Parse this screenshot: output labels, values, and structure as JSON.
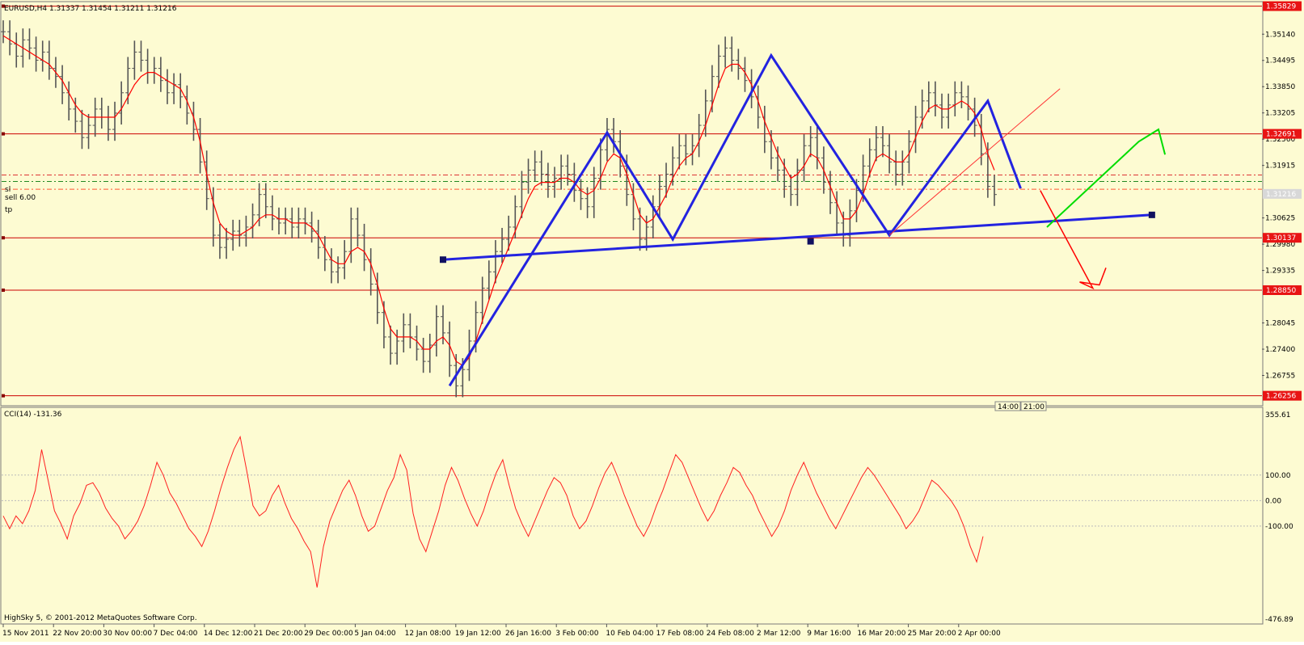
{
  "main_chart": {
    "header_text": "EURUSD,H4  1.31337 1.31454 1.31211 1.31216",
    "line_label_sl": "sl",
    "line_label_sell": "sell 6.00",
    "line_label_tp": "tp",
    "footer_text": "HighSky 5, © 2001-2012 MetaQuotes Software Corp."
  },
  "indicator": {
    "header_text": "CCI(14) -131.36"
  },
  "time_axis_labels": [
    "15 Nov 2011",
    "22 Nov 20:00",
    "30 Nov 00:00",
    "7 Dec 04:00",
    "14 Dec 12:00",
    "21 Dec 20:00",
    "29 Dec 00:00",
    "5 Jan 04:00",
    "12 Jan 08:00",
    "19 Jan 12:00",
    "26 Jan 16:00",
    "3 Feb 00:00",
    "10 Feb 04:00",
    "17 Feb 08:00",
    "24 Feb 08:00",
    "2 Mar 12:00",
    "9 Mar 16:00",
    "16 Mar 20:00",
    "25 Mar 20:00",
    "2 Apr 00:00"
  ],
  "session_labels": [
    "14:00",
    "21:00"
  ],
  "colors": {
    "background": "#fdfbd2",
    "price_bars": "#555555",
    "moving_average": "#ff0000",
    "pattern": "#2323e0",
    "forecast_up": "#00dd00",
    "forecast_down": "#ff0000",
    "level_line": "#cc0000",
    "grid": "#bbbbbb"
  },
  "chart_data": [
    {
      "type": "line",
      "symbol": "EURUSD",
      "timeframe": "H4",
      "ylim": [
        1.2605,
        1.359
      ],
      "y_ticks": [
        "1.35140",
        "1.34495",
        "1.33850",
        "1.33205",
        "1.32560",
        "1.31915",
        "1.30625",
        "1.29980",
        "1.29335",
        "1.28045",
        "1.27400",
        "1.26755"
      ],
      "price_tags": [
        "1.35829",
        "1.32691",
        "1.31216",
        "1.30137",
        "1.28850",
        "1.26256"
      ],
      "horizontal_levels": [
        1.35829,
        1.32691,
        1.30137,
        1.2885,
        1.26256
      ],
      "order_lines": [
        1.3168,
        1.3152,
        1.3133
      ],
      "ohlc_close": [
        1.352,
        1.349,
        1.346,
        1.35,
        1.348,
        1.345,
        1.347,
        1.343,
        1.341,
        1.337,
        1.333,
        1.33,
        1.326,
        1.329,
        1.333,
        1.331,
        1.328,
        1.332,
        1.337,
        1.343,
        1.347,
        1.345,
        1.342,
        1.343,
        1.34,
        1.337,
        1.339,
        1.336,
        1.332,
        1.328,
        1.32,
        1.311,
        1.302,
        1.299,
        1.301,
        1.303,
        1.302,
        1.304,
        1.307,
        1.312,
        1.309,
        1.306,
        1.305,
        1.306,
        1.304,
        1.306,
        1.305,
        1.303,
        1.299,
        1.296,
        1.293,
        1.294,
        1.298,
        1.306,
        1.302,
        1.296,
        1.29,
        1.283,
        1.277,
        1.273,
        1.276,
        1.28,
        1.277,
        1.274,
        1.271,
        1.275,
        1.282,
        1.278,
        1.27,
        1.265,
        1.269,
        1.276,
        1.283,
        1.289,
        1.293,
        1.298,
        1.301,
        1.304,
        1.309,
        1.315,
        1.318,
        1.32,
        1.317,
        1.314,
        1.316,
        1.319,
        1.317,
        1.313,
        1.311,
        1.309,
        1.316,
        1.323,
        1.328,
        1.325,
        1.319,
        1.312,
        1.306,
        1.301,
        1.304,
        1.309,
        1.314,
        1.317,
        1.321,
        1.324,
        1.322,
        1.324,
        1.329,
        1.335,
        1.341,
        1.346,
        1.348,
        1.345,
        1.343,
        1.34,
        1.336,
        1.331,
        1.325,
        1.321,
        1.318,
        1.314,
        1.312,
        1.318,
        1.324,
        1.326,
        1.321,
        1.315,
        1.31,
        1.305,
        1.302,
        1.308,
        1.313,
        1.319,
        1.323,
        1.326,
        1.324,
        1.32,
        1.317,
        1.32,
        1.325,
        1.331,
        1.335,
        1.337,
        1.334,
        1.331,
        1.334,
        1.337,
        1.336,
        1.333,
        1.329,
        1.322,
        1.314,
        1.312
      ],
      "moving_average": [
        1.351,
        1.35,
        1.349,
        1.348,
        1.347,
        1.346,
        1.345,
        1.344,
        1.342,
        1.34,
        1.337,
        1.334,
        1.332,
        1.331,
        1.331,
        1.331,
        1.331,
        1.331,
        1.333,
        1.336,
        1.339,
        1.341,
        1.342,
        1.342,
        1.341,
        1.34,
        1.339,
        1.338,
        1.335,
        1.331,
        1.325,
        1.317,
        1.31,
        1.305,
        1.303,
        1.302,
        1.302,
        1.303,
        1.304,
        1.306,
        1.307,
        1.307,
        1.306,
        1.306,
        1.305,
        1.305,
        1.305,
        1.304,
        1.302,
        1.299,
        1.296,
        1.295,
        1.295,
        1.298,
        1.299,
        1.298,
        1.295,
        1.29,
        1.284,
        1.279,
        1.277,
        1.277,
        1.277,
        1.276,
        1.274,
        1.274,
        1.276,
        1.277,
        1.275,
        1.271,
        1.27,
        1.272,
        1.276,
        1.281,
        1.286,
        1.291,
        1.295,
        1.299,
        1.303,
        1.307,
        1.311,
        1.314,
        1.315,
        1.315,
        1.315,
        1.316,
        1.316,
        1.315,
        1.313,
        1.312,
        1.313,
        1.316,
        1.32,
        1.322,
        1.321,
        1.317,
        1.312,
        1.307,
        1.305,
        1.306,
        1.309,
        1.312,
        1.316,
        1.319,
        1.321,
        1.322,
        1.325,
        1.329,
        1.334,
        1.339,
        1.343,
        1.344,
        1.344,
        1.342,
        1.339,
        1.335,
        1.33,
        1.326,
        1.322,
        1.319,
        1.316,
        1.317,
        1.319,
        1.322,
        1.321,
        1.318,
        1.314,
        1.31,
        1.306,
        1.306,
        1.308,
        1.312,
        1.317,
        1.321,
        1.322,
        1.321,
        1.32,
        1.32,
        1.322,
        1.326,
        1.33,
        1.333,
        1.334,
        1.333,
        1.333,
        1.334,
        1.335,
        1.334,
        1.332,
        1.328,
        1.322,
        1.318
      ],
      "pattern_zigzag": [
        [
          68,
          1.265
        ],
        [
          92,
          1.3272
        ],
        [
          102,
          1.301
        ],
        [
          117,
          1.3462
        ],
        [
          135,
          1.302
        ],
        [
          150,
          1.335
        ],
        [
          155,
          1.3135
        ]
      ],
      "neckline": [
        [
          67,
          1.296
        ],
        [
          175,
          1.307
        ]
      ],
      "neckline_markers": [
        [
          67,
          1.296
        ],
        [
          123,
          1.3005
        ],
        [
          175,
          1.307
        ]
      ],
      "upper_trendline": [
        [
          135,
          1.302
        ],
        [
          161,
          1.338
        ]
      ],
      "forecast_up": [
        [
          159,
          1.304
        ],
        [
          173,
          1.325
        ],
        [
          176,
          1.328
        ],
        [
          177,
          1.3218
        ]
      ],
      "forecast_down": [
        [
          158,
          1.313
        ],
        [
          166,
          1.289
        ],
        [
          164,
          1.2905
        ],
        [
          167,
          1.2898
        ],
        [
          168,
          1.294
        ]
      ]
    },
    {
      "type": "line",
      "name": "CCI(14)",
      "ylim": [
        -476.89,
        355.61
      ],
      "y_ticks": [
        "355.61",
        "100.00",
        "0.00",
        "-100.00",
        "-476.89"
      ],
      "levels": [
        100,
        0,
        -100
      ],
      "values": [
        -60,
        -110,
        -60,
        -90,
        -40,
        40,
        200,
        80,
        -40,
        -90,
        -150,
        -60,
        -10,
        60,
        70,
        30,
        -30,
        -70,
        -100,
        -150,
        -120,
        -80,
        -20,
        60,
        150,
        100,
        30,
        -10,
        -60,
        -110,
        -140,
        -180,
        -120,
        -40,
        50,
        130,
        200,
        250,
        120,
        -20,
        -60,
        -40,
        20,
        60,
        -10,
        -70,
        -110,
        -160,
        -200,
        -340,
        -180,
        -80,
        -20,
        40,
        80,
        20,
        -60,
        -120,
        -100,
        -30,
        40,
        90,
        180,
        120,
        -50,
        -150,
        -200,
        -120,
        -40,
        60,
        130,
        80,
        10,
        -50,
        -100,
        -40,
        40,
        110,
        160,
        60,
        -30,
        -90,
        -140,
        -80,
        -20,
        40,
        90,
        70,
        20,
        -60,
        -110,
        -80,
        -20,
        50,
        110,
        150,
        90,
        20,
        -40,
        -100,
        -140,
        -90,
        -20,
        40,
        110,
        180,
        150,
        90,
        30,
        -30,
        -80,
        -40,
        20,
        70,
        130,
        110,
        60,
        20,
        -40,
        -90,
        -140,
        -100,
        -40,
        40,
        100,
        150,
        90,
        30,
        -20,
        -70,
        -110,
        -60,
        -10,
        40,
        90,
        130,
        100,
        60,
        20,
        -20,
        -60,
        -110,
        -80,
        -40,
        20,
        80,
        60,
        30,
        0,
        -40,
        -100,
        -180,
        -240,
        -140
      ]
    }
  ]
}
